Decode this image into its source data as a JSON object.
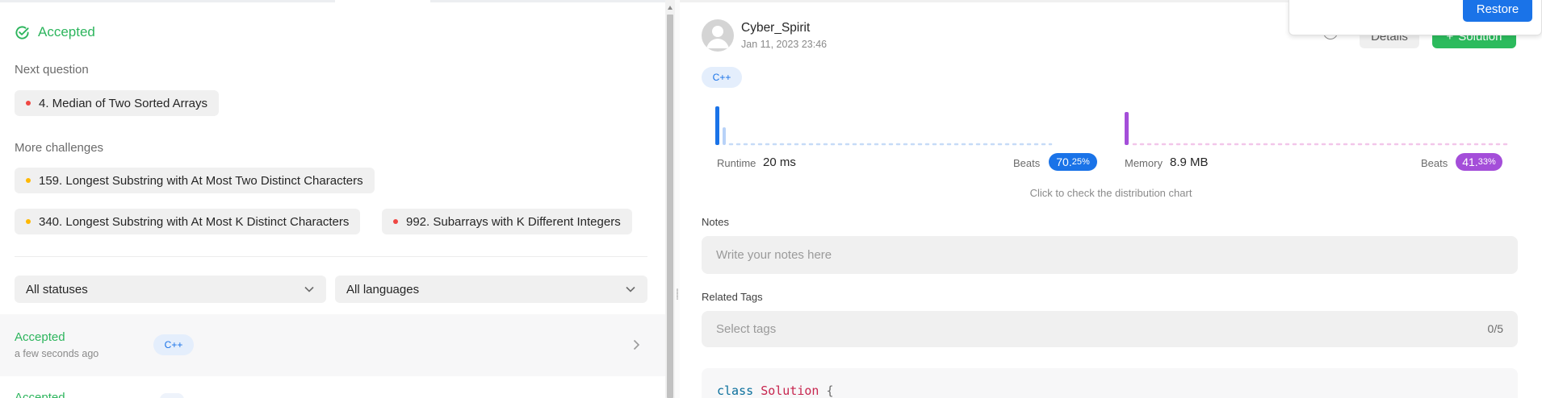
{
  "left": {
    "result_title": "Accepted",
    "next_question_label": "Next question",
    "next_question": {
      "label": "4. Median of Two Sorted Arrays",
      "difficulty_color": "#ef4743"
    },
    "more_challenges_label": "More challenges",
    "challenges": [
      {
        "label": "159. Longest Substring with At Most Two Distinct Characters",
        "difficulty_color": "#ffb800"
      },
      {
        "label": "340. Longest Substring with At Most K Distinct Characters",
        "difficulty_color": "#ffb800"
      },
      {
        "label": "992. Subarrays with K Different Integers",
        "difficulty_color": "#ef4743"
      }
    ],
    "filters": {
      "status": "All statuses",
      "language": "All languages"
    },
    "submissions": [
      {
        "status": "Accepted",
        "time": "a few seconds ago",
        "language": "C++"
      },
      {
        "status": "Accepted"
      }
    ]
  },
  "right": {
    "user": {
      "name": "Cyber_Spirit",
      "date": "Jan 11, 2023 23:46"
    },
    "buttons": {
      "details": "Details",
      "solution": "Solution",
      "restore": "Restore"
    },
    "language_tag": "C++",
    "runtime": {
      "label": "Runtime",
      "value": "20 ms",
      "beats_label": "Beats",
      "beats_int": "70.",
      "beats_frac": "25%",
      "color": "#1a73e8"
    },
    "memory": {
      "label": "Memory",
      "value": "8.9 MB",
      "beats_label": "Beats",
      "beats_int": "41.",
      "beats_frac": "33%",
      "color": "#a44ed9"
    },
    "hint": "Click to check the distribution chart",
    "notes": {
      "label": "Notes",
      "placeholder": "Write your notes here"
    },
    "tags": {
      "label": "Related Tags",
      "placeholder": "Select tags",
      "count": "0/5"
    },
    "code": {
      "keyword": "class",
      "class_name": "Solution",
      "brace": "{"
    }
  },
  "colors": {
    "accepted": "#2db55d",
    "accent": "#1a73e8",
    "solution_green": "#2cbb5d",
    "memory_purple": "#a44ed9"
  }
}
